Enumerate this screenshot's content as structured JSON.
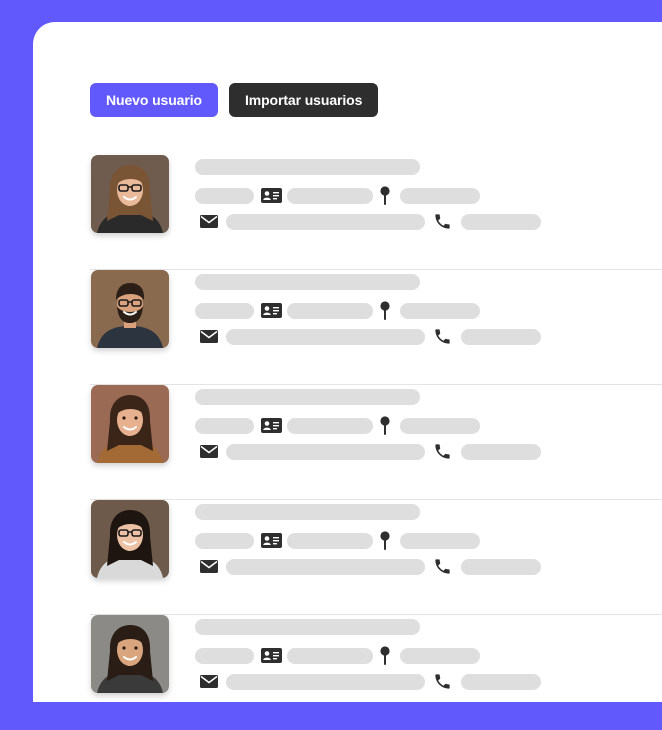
{
  "toolbar": {
    "new_user_label": "Nuevo usuario",
    "import_users_label": "Importar usuarios"
  },
  "colors": {
    "page_background": "#6159fb",
    "primary_button": "#6159fb",
    "dark_button": "#2e2e2e",
    "placeholder_bar": "#dedede",
    "icon": "#2e2e2e"
  },
  "users": [
    {
      "avatar": {
        "skin": "#e9b99a",
        "hair": "#7a5535",
        "shirt": "#2a2a2a",
        "bg": "#6f5c4e",
        "glasses": true
      }
    },
    {
      "avatar": {
        "skin": "#d9a27c",
        "hair": "#2b1f17",
        "shirt": "#2c3440",
        "bg": "#8a6a4e",
        "glasses": true,
        "beard": true
      }
    },
    {
      "avatar": {
        "skin": "#e7b08e",
        "hair": "#3b2418",
        "shirt": "#a36a35",
        "bg": "#9b6a55",
        "glasses": false
      }
    },
    {
      "avatar": {
        "skin": "#edc1a6",
        "hair": "#1e1510",
        "shirt": "#d9d9d9",
        "bg": "#6e5a4a",
        "glasses": true
      }
    },
    {
      "avatar": {
        "skin": "#d8a57f",
        "hair": "#2a1d15",
        "shirt": "#3a3a3a",
        "bg": "#8c8a86",
        "glasses": false
      }
    }
  ],
  "icons": {
    "id_card": "id-card-icon",
    "location": "location-pin-icon",
    "email": "envelope-icon",
    "phone": "phone-icon"
  }
}
